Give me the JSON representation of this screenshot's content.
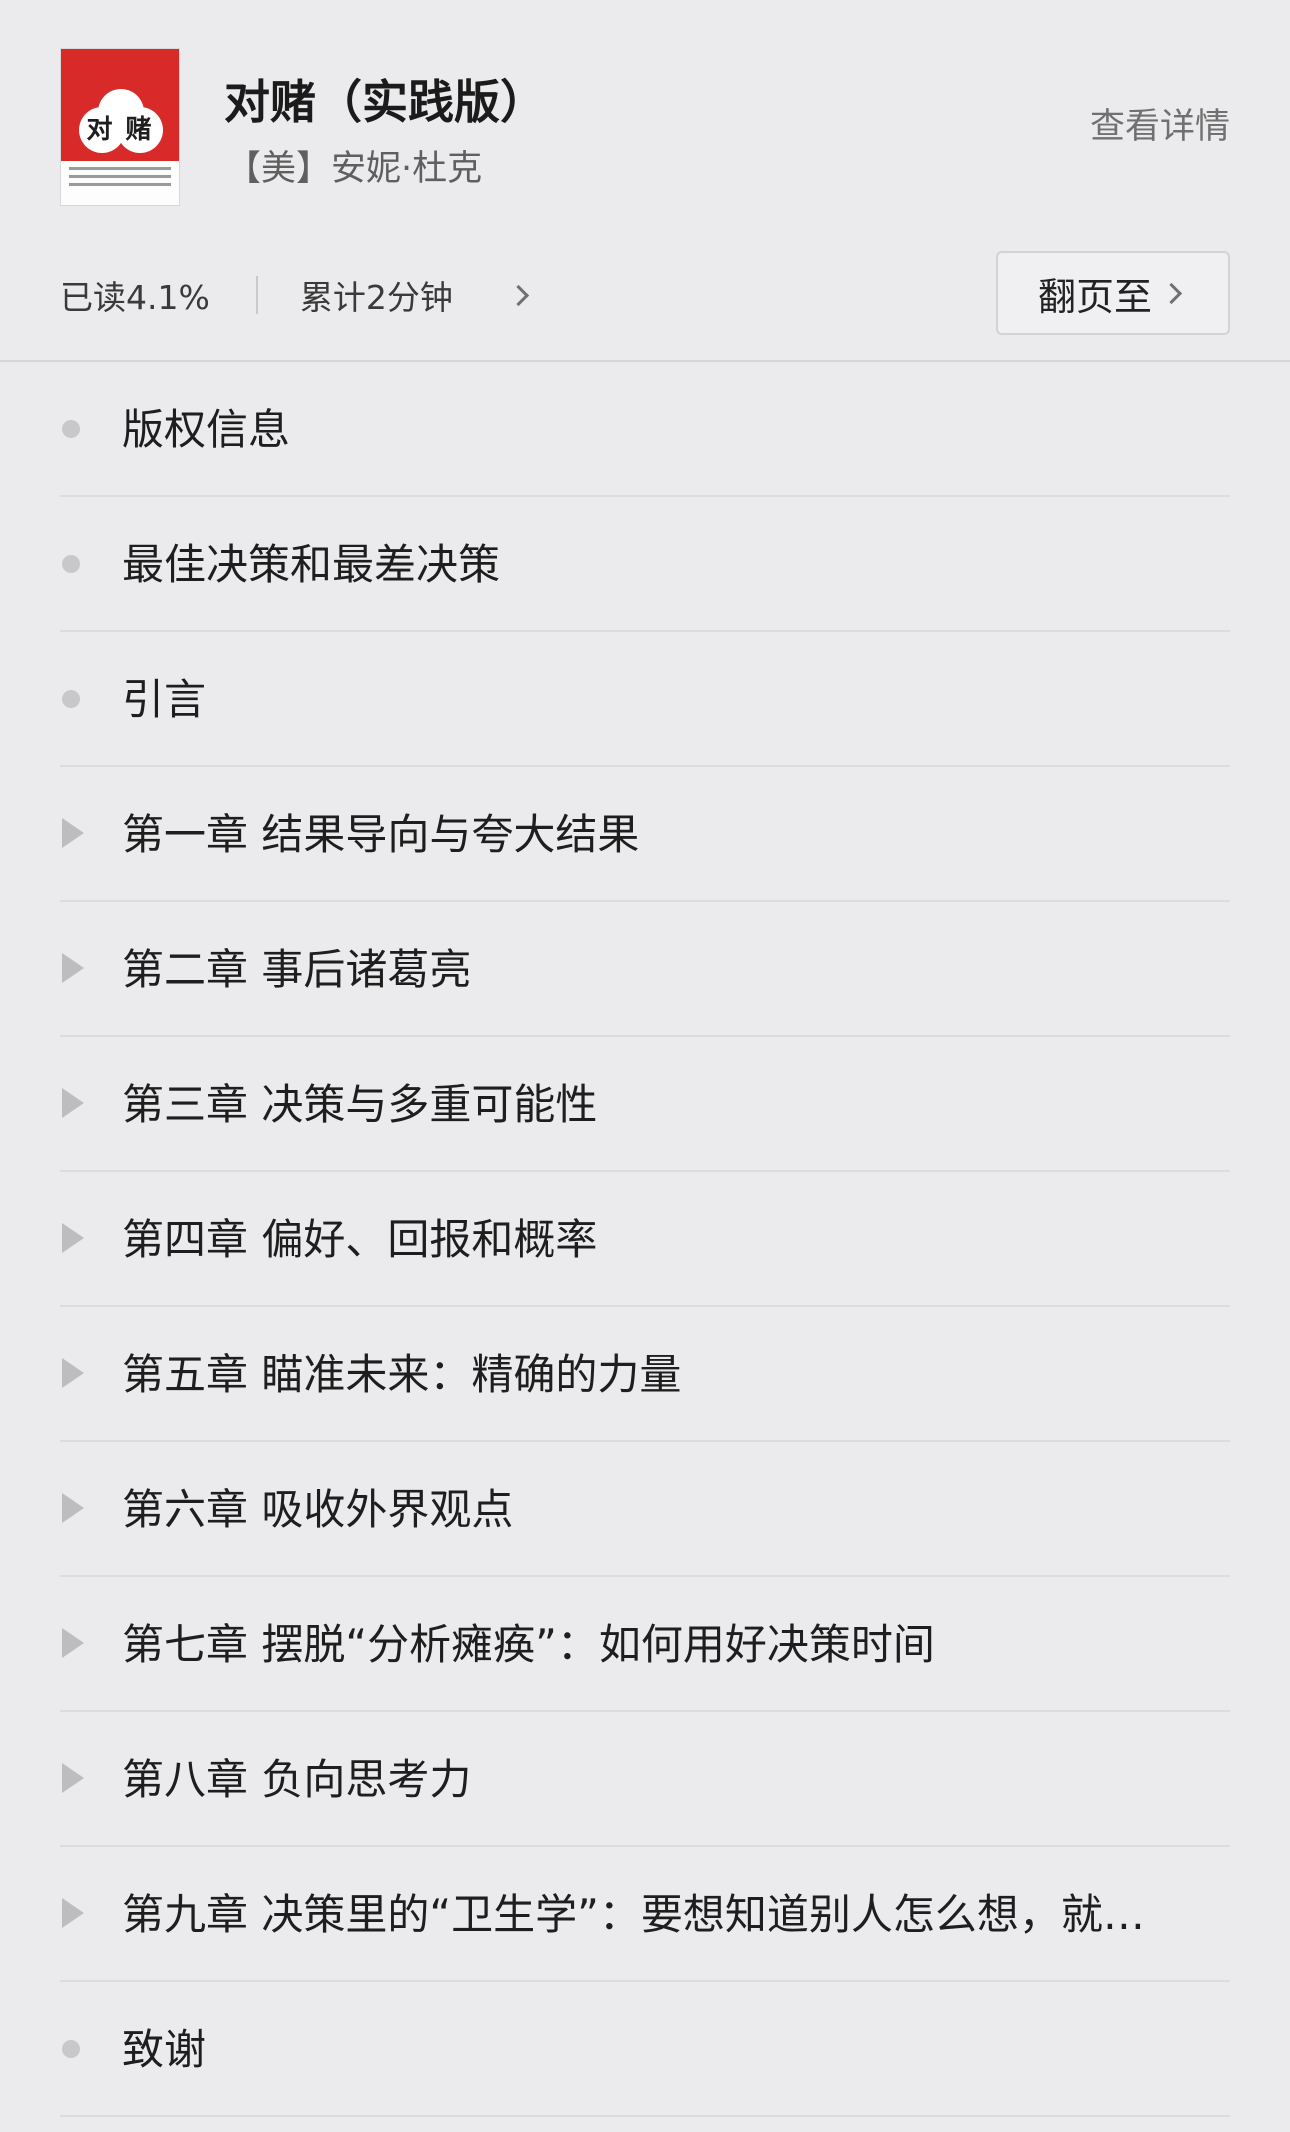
{
  "book": {
    "title": "对赌（实践版）",
    "author": "【美】安妮·杜克",
    "details_label": "查看详情",
    "cover_title": "对 赌"
  },
  "progress": {
    "read_label": "已读4.1%",
    "time_label": "累计2分钟",
    "goto_label": "翻页至"
  },
  "toc": [
    {
      "label": "版权信息",
      "marker": "dot"
    },
    {
      "label": "最佳决策和最差决策",
      "marker": "dot"
    },
    {
      "label": "引言",
      "marker": "dot"
    },
    {
      "label": "第一章 结果导向与夸大结果",
      "marker": "triangle"
    },
    {
      "label": "第二章 事后诸葛亮",
      "marker": "triangle"
    },
    {
      "label": "第三章 决策与多重可能性",
      "marker": "triangle"
    },
    {
      "label": "第四章 偏好、回报和概率",
      "marker": "triangle"
    },
    {
      "label": "第五章 瞄准未来：精确的力量",
      "marker": "triangle"
    },
    {
      "label": "第六章 吸收外界观点",
      "marker": "triangle"
    },
    {
      "label": "第七章 摆脱“分析瘫痪”：如何用好决策时间",
      "marker": "triangle"
    },
    {
      "label": "第八章 负向思考力",
      "marker": "triangle"
    },
    {
      "label": "第九章 决策里的“卫生学”：要想知道别人怎么想，就…",
      "marker": "triangle"
    },
    {
      "label": "致谢",
      "marker": "dot"
    }
  ],
  "colors": {
    "background": "#ebebed",
    "cover_red": "#d92a2a",
    "marker": "#c8c8cb"
  }
}
